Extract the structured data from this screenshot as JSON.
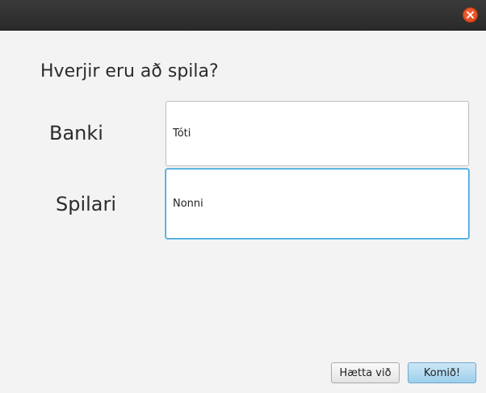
{
  "window": {
    "close_icon": "close-icon"
  },
  "dialog": {
    "heading": "Hverjir eru að spila?",
    "fields": [
      {
        "label": "Banki",
        "value": "Tóti"
      },
      {
        "label": "Spilari",
        "value": "Nonni"
      }
    ],
    "buttons": {
      "cancel_label": "Hætta við",
      "ok_label": "Komið!"
    }
  },
  "colors": {
    "titlebar": "#2a2a2a",
    "close_button": "#e6512a",
    "focus_border": "#3aa0d8",
    "ok_button": "#a9d5ef"
  }
}
